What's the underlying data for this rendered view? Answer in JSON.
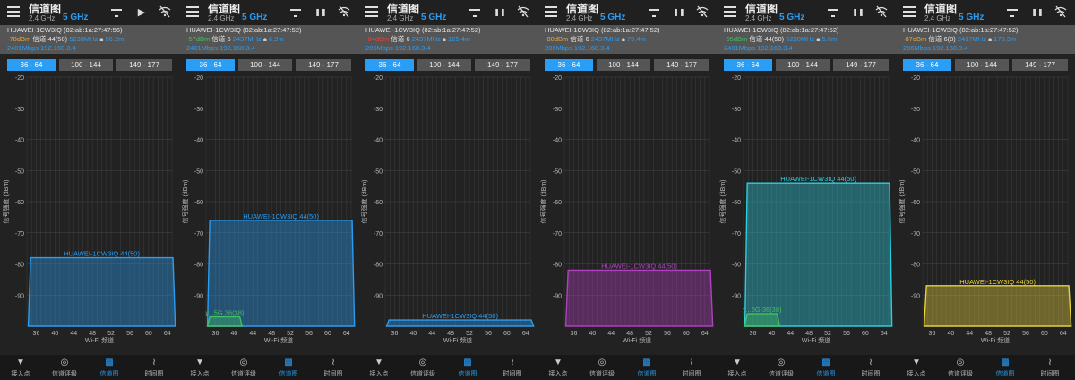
{
  "app": {
    "title": "信道图",
    "band_24": "2.4 GHz",
    "band_5": "5 GHz",
    "tabs": [
      "36 - 64",
      "100 - 144",
      "149 - 177"
    ],
    "y_axis_label": "信号强度 (dBm)",
    "x_axis_label": "Wi-Fi 频道",
    "nav": [
      "接入点",
      "信道评级",
      "信道图",
      "时间图"
    ],
    "active_nav_index": 2,
    "icons": {
      "menu": "menu-icon",
      "filter": "filter-icon",
      "pause": "pause-icon",
      "play": "play-icon",
      "wifi_off": "wifi-off-icon"
    }
  },
  "colors": {
    "accent": "#2a9df4",
    "warn": "#e8a93a",
    "good": "#43c167",
    "bad": "#e0453a"
  },
  "panels": [
    {
      "ssid_line": "HUAWEI-1CW3IQ (82:ab:1a:27:47:56)",
      "signal": "-78dBm",
      "signal_color": "#e8a93a",
      "channel_info": "信道 44(50)",
      "freq": "5230MHz",
      "dist": "56.2m",
      "speed_ip": "2401Mbps 192.168.3.4",
      "play_state": "play-icon",
      "chart_data": {
        "type": "area",
        "y_range": [
          -100,
          -20
        ],
        "x_ticks": [
          36,
          40,
          44,
          48,
          52,
          56,
          60,
          64
        ],
        "y_ticks": [
          -20,
          -30,
          -40,
          -50,
          -60,
          -70,
          -80,
          -90
        ],
        "series": [
          {
            "label": "HUAWEI-1CW3IQ 44(50)",
            "dbm": -78,
            "ch_start": 36,
            "ch_end": 64,
            "color": "#2a9df4"
          }
        ]
      }
    },
    {
      "ssid_line": "HUAWEI-1CW3IQ (82:ab:1a:27:47:52)",
      "signal": "-57dBm",
      "signal_color": "#43c167",
      "channel_info": "信道 6",
      "freq": "2437MHz",
      "dist": "6.9m",
      "speed_ip": "2401Mbps 192.168.3.4",
      "play_state": "pause-icon",
      "chart_data": {
        "type": "area",
        "y_range": [
          -100,
          -20
        ],
        "x_ticks": [
          36,
          40,
          44,
          48,
          52,
          56,
          60,
          64
        ],
        "y_ticks": [
          -20,
          -30,
          -40,
          -50,
          -60,
          -70,
          -80,
          -90
        ],
        "series": [
          {
            "label": "HUAWEI-1CW3IQ 44(50)",
            "dbm": -66,
            "ch_start": 36,
            "ch_end": 64,
            "color": "#2a9df4"
          },
          {
            "label": "y...5G 36(38)",
            "dbm": -97,
            "ch_start": 36,
            "ch_end": 40,
            "color": "#43c167"
          }
        ]
      }
    },
    {
      "ssid_line": "HUAWEI-1CW3IQ (82:ab:1a:27:47:52)",
      "signal": "-84dBm",
      "signal_color": "#e0453a",
      "channel_info": "信道 6",
      "freq": "2437MHz",
      "dist": "125.4m",
      "speed_ip": "286Mbps 192.168.3.4",
      "play_state": "pause-icon",
      "chart_data": {
        "type": "area",
        "y_range": [
          -100,
          -20
        ],
        "x_ticks": [
          36,
          40,
          44,
          48,
          52,
          56,
          60,
          64
        ],
        "y_ticks": [
          -20,
          -30,
          -40,
          -50,
          -60,
          -70,
          -80,
          -90
        ],
        "series": [
          {
            "label": "HUAWEI-1CW3IQ 44(50)",
            "dbm": -98,
            "ch_start": 36,
            "ch_end": 64,
            "color": "#2a9df4"
          }
        ]
      }
    },
    {
      "ssid_line": "HUAWEI-1CW3IQ (82:ab:1a:27:47:52)",
      "signal": "-80dBm",
      "signal_color": "#e8a93a",
      "channel_info": "信道 6",
      "freq": "2437MHz",
      "dist": "79.4m",
      "speed_ip": "286Mbps 192.168.3.4",
      "play_state": "pause-icon",
      "chart_data": {
        "type": "area",
        "y_range": [
          -100,
          -20
        ],
        "x_ticks": [
          36,
          40,
          44,
          48,
          52,
          56,
          60,
          64
        ],
        "y_ticks": [
          -20,
          -30,
          -40,
          -50,
          -60,
          -70,
          -80,
          -90
        ],
        "series": [
          {
            "label": "HUAWEI-1CW3IQ 44(50)",
            "dbm": -82,
            "ch_start": 36,
            "ch_end": 64,
            "color": "#b040c0"
          }
        ]
      }
    },
    {
      "ssid_line": "HUAWEI-1CW3IQ (82:ab:1a:27:47:52)",
      "signal": "-55dBm",
      "signal_color": "#43c167",
      "channel_info": "信道 44(50)",
      "freq": "5230MHz",
      "dist": "5.6m",
      "speed_ip": "2401Mbps 192.168.3.4",
      "play_state": "pause-icon",
      "chart_data": {
        "type": "area",
        "y_range": [
          -100,
          -20
        ],
        "x_ticks": [
          36,
          40,
          44,
          48,
          52,
          56,
          60,
          64
        ],
        "y_ticks": [
          -20,
          -30,
          -40,
          -50,
          -60,
          -70,
          -80,
          -90
        ],
        "series": [
          {
            "label": "HUAWEI-1CW3IQ 44(50)",
            "dbm": -54,
            "ch_start": 36,
            "ch_end": 64,
            "color": "#2ad0e0"
          },
          {
            "label": "y...5G 36(38)",
            "dbm": -96,
            "ch_start": 36,
            "ch_end": 40,
            "color": "#43c167"
          }
        ]
      }
    },
    {
      "ssid_line": "HUAWEI-1CW3IQ (82:ab:1a:27:47:52)",
      "signal": "-87dBm",
      "signal_color": "#e8a93a",
      "channel_info": "信道 6(8)",
      "freq": "2437MHz",
      "dist": "178.3m",
      "speed_ip": "286Mbps 192.168.3.4",
      "play_state": "pause-icon",
      "chart_data": {
        "type": "area",
        "y_range": [
          -100,
          -20
        ],
        "x_ticks": [
          36,
          40,
          44,
          48,
          52,
          56,
          60,
          64
        ],
        "y_ticks": [
          -20,
          -30,
          -40,
          -50,
          -60,
          -70,
          -80,
          -90
        ],
        "series": [
          {
            "label": "HUAWEI-1CW3IQ 44(50)",
            "dbm": -87,
            "ch_start": 36,
            "ch_end": 64,
            "color": "#e8d23a"
          }
        ]
      }
    }
  ]
}
